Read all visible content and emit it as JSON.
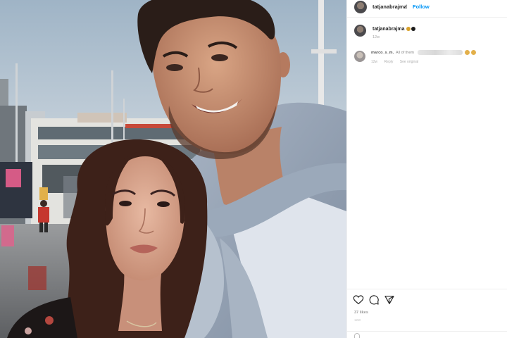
{
  "post": {
    "header": {
      "username": "tatjanabrajma",
      "separator": "•",
      "follow_label": "Follow"
    },
    "caption_comment": {
      "username": "tatjanabrajma",
      "time": "12w"
    },
    "reply_comment": {
      "username": "marco_s_m.",
      "text": "All of them",
      "time": "12w",
      "reply_label": "Reply",
      "see_translation": "See original"
    },
    "actions": {
      "like_icon": "heart-icon",
      "comment_icon": "comment-icon",
      "share_icon": "share-icon",
      "likes_text": "37 likes",
      "date_text": "12W"
    }
  },
  "colors": {
    "follow": "#0095f6",
    "text_primary": "#262626",
    "text_secondary": "#8e8e8e"
  }
}
